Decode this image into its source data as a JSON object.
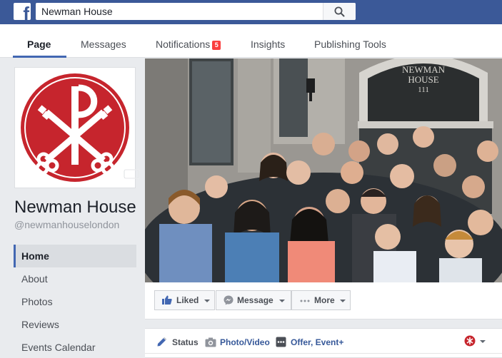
{
  "search": {
    "value": "Newman House",
    "placeholder": "Search"
  },
  "page_nav": {
    "tabs": [
      {
        "label": "Page"
      },
      {
        "label": "Messages"
      },
      {
        "label": "Notifications"
      },
      {
        "label": "Insights"
      },
      {
        "label": "Publishing Tools"
      }
    ],
    "notification_count": "5"
  },
  "page": {
    "name": "Newman House",
    "handle": "@newmanhouselondon"
  },
  "sidebar": {
    "items": [
      {
        "label": "Home"
      },
      {
        "label": "About"
      },
      {
        "label": "Photos"
      },
      {
        "label": "Reviews"
      },
      {
        "label": "Events Calendar"
      }
    ]
  },
  "cover_photo": {
    "building_sign_line1": "NEWMAN",
    "building_sign_line2": "HOUSE",
    "building_sign_number": "111"
  },
  "actions": {
    "liked_label": "Liked",
    "message_label": "Message",
    "more_label": "More"
  },
  "composer": {
    "status_label": "Status",
    "photo_video_label": "Photo/Video",
    "offer_event_label": "Offer, Event+"
  },
  "colors": {
    "brand_blue": "#3b5998",
    "accent_blue": "#4267b2",
    "logo_red": "#c6252d",
    "badge_red": "#fa3e3e"
  }
}
